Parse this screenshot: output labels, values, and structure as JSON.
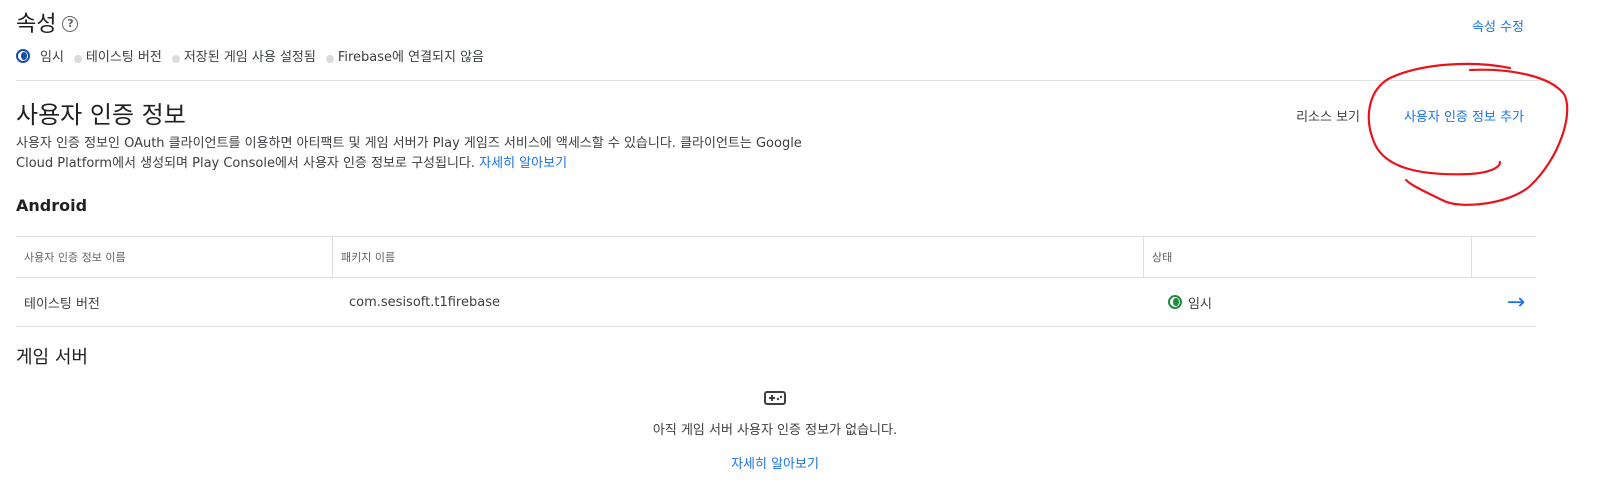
{
  "properties": {
    "title": "속성",
    "edit_link": "속성 수정",
    "chips": [
      "임시",
      "테이스팅 버전",
      "저장된 게임 사용 설정됨",
      "Firebase에 연결되지 않음"
    ]
  },
  "credentials": {
    "title": "사용자 인증 정보",
    "resources_link": "리소스 보기",
    "add_link": "사용자 인증 정보 추가",
    "description_line1": "사용자 인증 정보인 OAuth 클라이언트를 이용하면 아티팩트 및 게임 서버가 Play 게임즈 서비스에 액세스할 수 있습니다. 클라이언트는 Google",
    "description_line2": "Cloud Platform에서 생성되며 Play Console에서 사용자 인증 정보로 구성됩니다.",
    "learn_more": "자세히 알아보기"
  },
  "android": {
    "title": "Android",
    "columns": [
      "사용자 인증 정보 이름",
      "패키지 이름",
      "상태"
    ],
    "rows": [
      {
        "name": "테이스팅 버전",
        "package": "com.sesisoft.t1firebase",
        "status": "임시"
      }
    ]
  },
  "game_server": {
    "title": "게임 서버",
    "icon": "gamepad-icon",
    "empty_message": "아직 게임 서버 사용자 인증 정보가 없습니다.",
    "learn_more": "자세히 알아보기"
  },
  "colors": {
    "link": "#1a73e8",
    "annotation": "#e8141c",
    "status_green": "#1e8e3e"
  }
}
